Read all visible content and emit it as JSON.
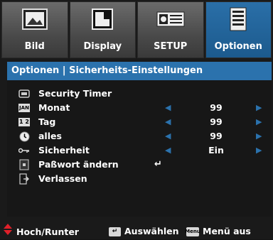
{
  "tabs": [
    {
      "label": "Bild",
      "icon": "picture-icon"
    },
    {
      "label": "Display",
      "icon": "display-icon"
    },
    {
      "label": "SETUP",
      "icon": "setup-icon"
    },
    {
      "label": "Optionen",
      "icon": "options-icon",
      "active": true
    }
  ],
  "title": "Optionen | Sicherheits-Einstellungen",
  "menu": [
    {
      "label": "Security Timer",
      "icon": "timer-icon"
    },
    {
      "label": "Monat",
      "icon": "month-icon",
      "icon_text": "JAN",
      "value": "99"
    },
    {
      "label": "Tag",
      "icon": "day-icon",
      "icon_text": "1 2",
      "value": "99"
    },
    {
      "label": "alles",
      "icon": "clock-icon",
      "value": "99"
    },
    {
      "label": "Sicherheit",
      "icon": "key-icon",
      "value": "Ein"
    },
    {
      "label": "Paßwort ändern",
      "icon": "password-icon",
      "value_glyph": "↵"
    },
    {
      "label": "Verlassen",
      "icon": "exit-icon"
    }
  ],
  "footer": {
    "nav": "Hoch/Runter",
    "select": "Auswählen",
    "menu_key": "Menu",
    "menu": "Menü aus"
  },
  "colors": {
    "accent": "#2b72ad",
    "nav_arrow": "#e0202a"
  }
}
